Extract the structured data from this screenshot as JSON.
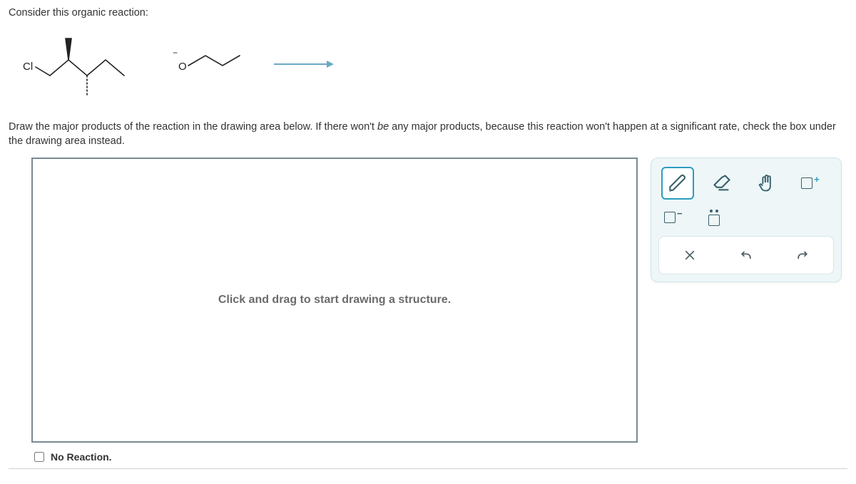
{
  "question": {
    "intro": "Consider this organic reaction:",
    "instructions_pre": "Draw the major products of the reaction in the drawing area below. If there won't ",
    "instructions_be": "be",
    "instructions_post": " any major products, because this reaction won't happen at a significant rate, check the box under the drawing area instead."
  },
  "reaction": {
    "substrate_label": "Cl",
    "reagent_label_neg": "−",
    "reagent_label_O": "O"
  },
  "canvas": {
    "placeholder": "Click and drag to start drawing a structure.",
    "no_reaction_label": "No Reaction."
  },
  "tools": {
    "pencil": "pencil-icon",
    "eraser": "eraser-icon",
    "grab": "hand-icon",
    "more": "more-panel-icon",
    "neg_charge": "negative-charge-icon",
    "lone_pair": "lone-pair-icon",
    "close": "close-icon",
    "undo": "undo-icon",
    "redo": "redo-icon"
  }
}
